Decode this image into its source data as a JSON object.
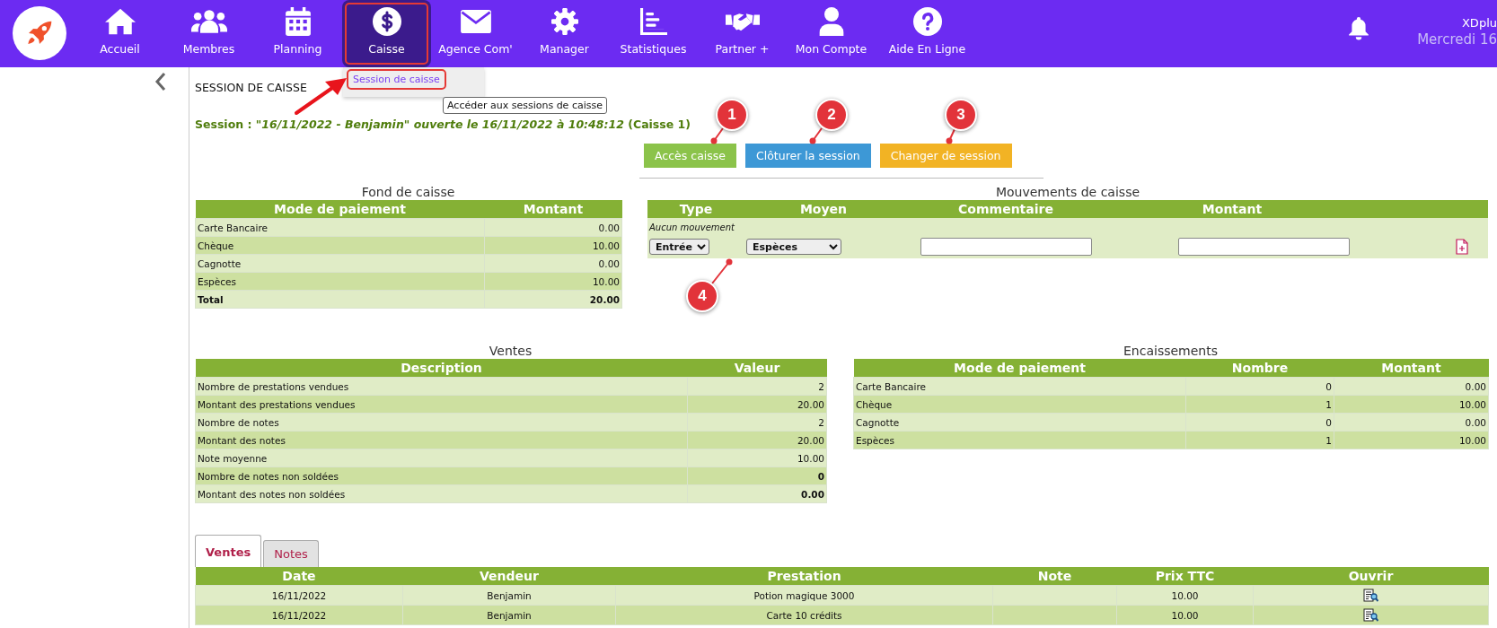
{
  "nav": {
    "items": [
      {
        "label": "Accueil",
        "selected": false,
        "highlighted": false
      },
      {
        "label": "Membres",
        "selected": false,
        "highlighted": false
      },
      {
        "label": "Planning",
        "selected": false,
        "highlighted": false
      },
      {
        "label": "Caisse",
        "selected": true,
        "highlighted": true
      },
      {
        "label": "Agence Com'",
        "selected": false,
        "highlighted": false
      },
      {
        "label": "Manager",
        "selected": false,
        "highlighted": false
      },
      {
        "label": "Statistiques",
        "selected": false,
        "highlighted": false
      },
      {
        "label": "Partner +",
        "selected": false,
        "highlighted": false
      },
      {
        "label": "Mon Compte",
        "selected": false,
        "highlighted": false
      },
      {
        "label": "Aide En Ligne",
        "selected": false,
        "highlighted": false
      }
    ],
    "user": "XDplu",
    "date": "Mercredi 16"
  },
  "menu": {
    "items": [
      {
        "label": "Session de caisse",
        "highlighted": true
      }
    ],
    "tooltip": "Accéder aux sessions de caisse"
  },
  "page_title": "SESSION DE CAISSE",
  "session_info": "Session : *\"16/11/2022 - Benjamin\" ouverte le 16/11/2022 à 10:48:12* (Caisse 1)",
  "actions": [
    {
      "label": "Accès caisse",
      "color": "#8bc34a"
    },
    {
      "label": "Clôturer la session",
      "color": "#3d98d6"
    },
    {
      "label": "Changer de session",
      "color": "#f2b324"
    }
  ],
  "fond_de_caisse": {
    "title": "Fond de caisse",
    "columns": [
      "Mode de paiement",
      "Montant"
    ],
    "rows": [
      {
        "cells": [
          "Carte Bancaire",
          "0.00"
        ],
        "bold": false
      },
      {
        "cells": [
          "Chèque",
          "10.00"
        ],
        "bold": false
      },
      {
        "cells": [
          "Cagnotte",
          "0.00"
        ],
        "bold": false
      },
      {
        "cells": [
          "Espèces",
          "10.00"
        ],
        "bold": false
      },
      {
        "cells": [
          "Total",
          "20.00"
        ],
        "bold": true
      }
    ]
  },
  "mouvements": {
    "title": "Mouvements de caisse",
    "columns": [
      "Type",
      "Moyen",
      "Commentaire",
      "Montant"
    ],
    "empty_message": "Aucun mouvement",
    "form": {
      "type": "Entrée",
      "moyen": "Espèces"
    }
  },
  "ventes": {
    "title": "Ventes",
    "columns": [
      "Description",
      "Valeur"
    ],
    "rows": [
      {
        "cells": [
          "Nombre de prestations vendues",
          "2"
        ],
        "bold_value": false
      },
      {
        "cells": [
          "Montant des prestations vendues",
          "20.00"
        ],
        "bold_value": false
      },
      {
        "cells": [
          "Nombre de notes",
          "2"
        ],
        "bold_value": false
      },
      {
        "cells": [
          "Montant des notes",
          "20.00"
        ],
        "bold_value": false
      },
      {
        "cells": [
          "Note moyenne",
          "10.00"
        ],
        "bold_value": false
      },
      {
        "cells": [
          "Nombre de notes non soldées",
          "0"
        ],
        "bold_value": true
      },
      {
        "cells": [
          "Montant des notes non soldées",
          "0.00"
        ],
        "bold_value": true
      }
    ]
  },
  "encaissements": {
    "title": "Encaissements",
    "columns": [
      "Mode de paiement",
      "Nombre",
      "Montant"
    ],
    "rows": [
      {
        "cells": [
          "Carte Bancaire",
          "0",
          "0.00"
        ]
      },
      {
        "cells": [
          "Chèque",
          "1",
          "10.00"
        ]
      },
      {
        "cells": [
          "Cagnotte",
          "0",
          "0.00"
        ]
      },
      {
        "cells": [
          "Espèces",
          "1",
          "10.00"
        ]
      }
    ]
  },
  "tabs": [
    {
      "label": "Ventes",
      "selected": true
    },
    {
      "label": "Notes",
      "selected": false
    }
  ],
  "sales_table": {
    "columns": [
      "Date",
      "Vendeur",
      "Prestation",
      "Note",
      "Prix TTC",
      "Ouvrir"
    ],
    "rows": [
      {
        "date": "16/11/2022",
        "vendeur": "Benjamin",
        "prestation": "Potion magique 3000",
        "prix_ttc": "10.00"
      },
      {
        "date": "16/11/2022",
        "vendeur": "Benjamin",
        "prestation": "Carte 10 crédits",
        "prix_ttc": "10.00"
      }
    ]
  },
  "annotations": [
    {
      "label": "1"
    },
    {
      "label": "2"
    },
    {
      "label": "3"
    },
    {
      "label": "4"
    }
  ]
}
